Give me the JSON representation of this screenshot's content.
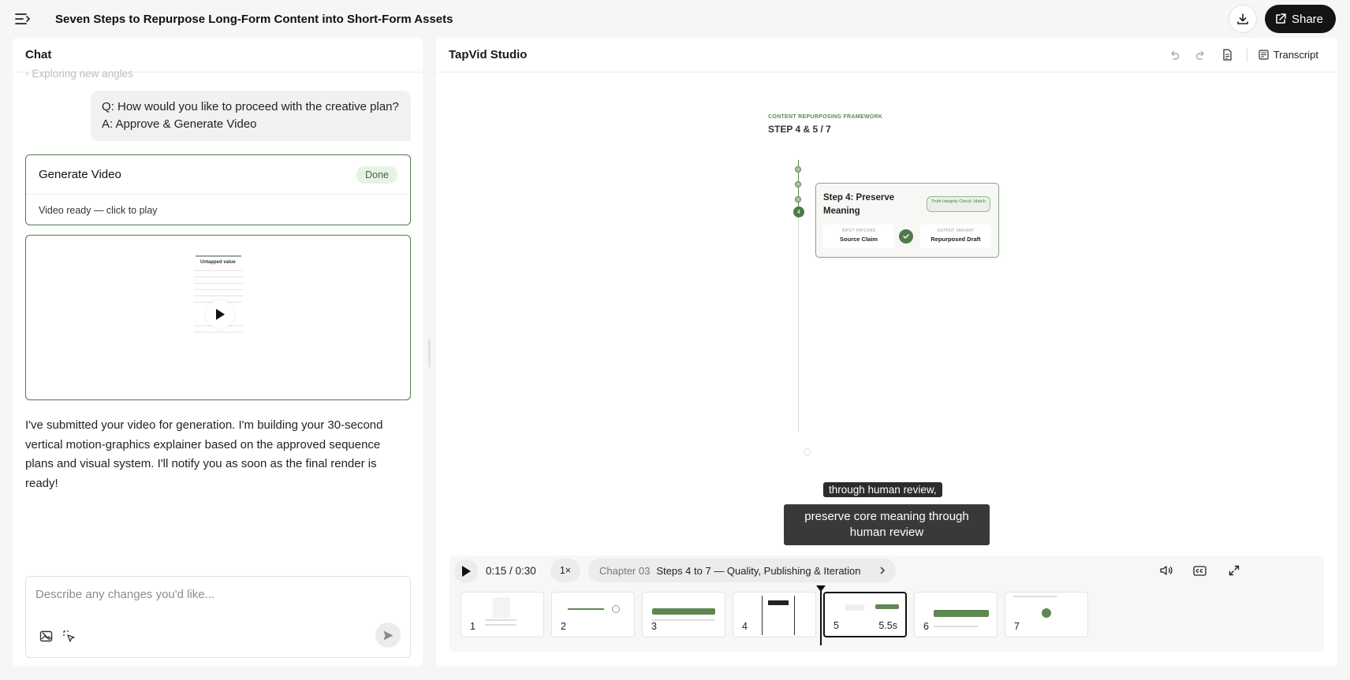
{
  "topbar": {
    "title": "Seven Steps to Repurpose Long-Form Content into Short-Form Assets",
    "share_label": "Share"
  },
  "chat": {
    "header": "Chat",
    "faded_line": "Exploring new angles",
    "qa_question": "Q: How would you like to proceed with the creative plan?",
    "qa_answer": "A: Approve & Generate Video",
    "gen_card": {
      "title": "Generate Video",
      "status": "Done",
      "subtitle": "Video ready — click to play"
    },
    "video_thumb_title": "Untapped value",
    "message": "I've submitted your video for generation. I'm building your 30-second vertical motion-graphics explainer based on the approved sequence plans and visual system. I'll notify you as soon as the final render is ready!",
    "composer_placeholder": "Describe any changes you'd like..."
  },
  "studio": {
    "title": "TapVid Studio",
    "transcript_label": "Transcript",
    "preview": {
      "kicker": "CONTENT REPURPOSING FRAMEWORK",
      "heading": "STEP 4 & 5 / 7",
      "step_title": "Step 4: Preserve Meaning",
      "chip": "Truth Integrity Check: Match",
      "input_label": "INPUT PAYLOAD",
      "input_value": "Source Claim",
      "output_label": "OUTPUT VARIANT",
      "output_value": "Repurposed Draft",
      "step_badge": "4",
      "caption_top": "through human review,",
      "caption_main": "preserve core meaning through human review"
    },
    "player": {
      "time": "0:15 / 0:30",
      "speed": "1×",
      "chapter_num": "Chapter 03",
      "chapter_title": "Steps 4 to 7 — Quality, Publishing & Iteration",
      "clips": [
        {
          "n": "1"
        },
        {
          "n": "2"
        },
        {
          "n": "3"
        },
        {
          "n": "4"
        },
        {
          "n": "5",
          "duration": "5.5s",
          "active": true
        },
        {
          "n": "6"
        },
        {
          "n": "7"
        }
      ]
    }
  },
  "colors": {
    "accent": "#4f7b4a",
    "dark": "#141414"
  }
}
